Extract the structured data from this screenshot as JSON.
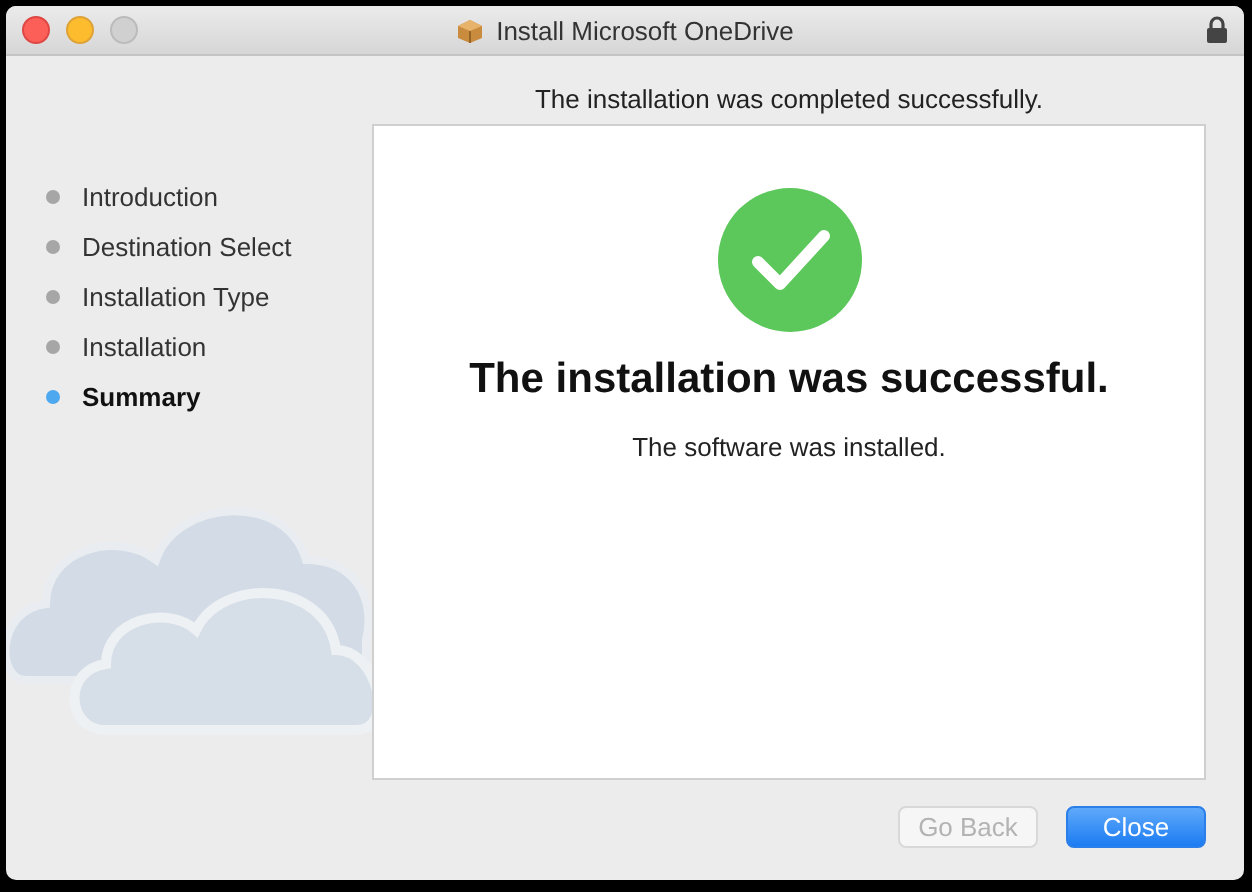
{
  "window": {
    "title": "Install Microsoft OneDrive"
  },
  "header": "The installation was completed successfully.",
  "steps": [
    {
      "label": "Introduction",
      "selected": false
    },
    {
      "label": "Destination Select",
      "selected": false
    },
    {
      "label": "Installation Type",
      "selected": false
    },
    {
      "label": "Installation",
      "selected": false
    },
    {
      "label": "Summary",
      "selected": true
    }
  ],
  "result": {
    "title": "The installation was successful.",
    "message": "The software was installed."
  },
  "buttons": [
    {
      "label": "Go Back",
      "disabled": true,
      "kind": "secondary"
    },
    {
      "label": "Close",
      "disabled": false,
      "kind": "primary"
    }
  ]
}
